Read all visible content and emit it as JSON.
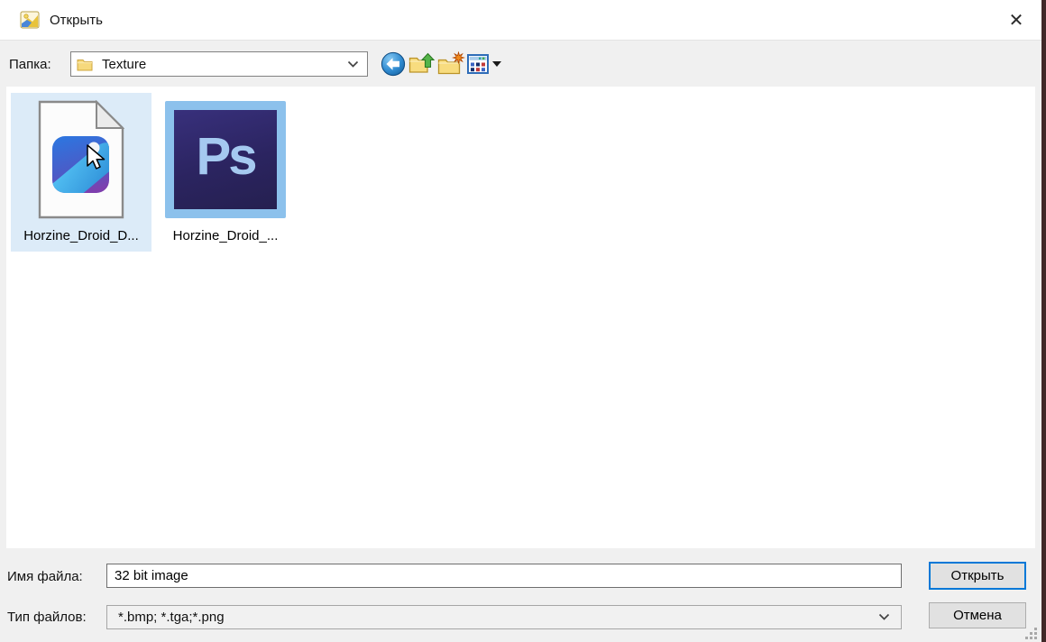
{
  "window": {
    "title": "Открыть",
    "close_glyph": "✕"
  },
  "toolbar": {
    "folder_label": "Папка:",
    "current_folder": "Texture",
    "icons": [
      "back-arrow-circle-icon",
      "folder-up-icon",
      "new-folder-icon",
      "view-grid-icon",
      "dropdown-caret-icon",
      "folder-icon",
      "chevron-down-icon"
    ]
  },
  "file_list": {
    "items": [
      {
        "name": "Horzine_Droid_D...",
        "kind": "image-file",
        "selected": true
      },
      {
        "name": "Horzine_Droid_...",
        "kind": "photoshop-file",
        "selected": false,
        "badge": "Ps"
      }
    ]
  },
  "footer": {
    "filename_label": "Имя файла:",
    "filename_value": "32 bit image",
    "filetype_label": "Тип файлов:",
    "filetype_value": "*.bmp; *.tga;*.png",
    "open_button": "Открыть",
    "cancel_button": "Отмена"
  },
  "colors": {
    "accent": "#0078d7",
    "selection_bg": "#dcebf8",
    "panel_bg": "#f0f0f0",
    "titlebar_bg": "#ffffff",
    "screen_edge": "#402828"
  }
}
